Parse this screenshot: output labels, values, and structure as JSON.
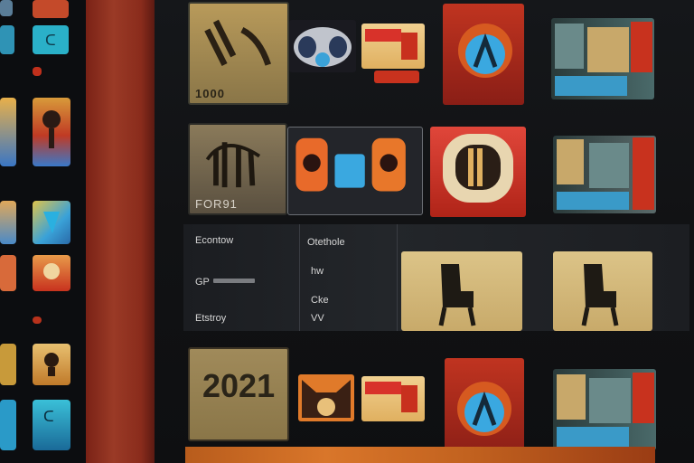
{
  "grid": {
    "row1": {
      "tile_label": "1000"
    },
    "row2": {
      "tile_label": "FOR91"
    },
    "row4": {
      "tile_label": "2021"
    }
  },
  "settings": {
    "col1_header": "Econtow",
    "col1_item1": "GP",
    "col1_item2": "Etstroy",
    "col2_header": "Otethole",
    "col2_item1": "hw",
    "col2_item2": "Cke",
    "col2_item3": "VV"
  },
  "colors": {
    "accent_red": "#c8321e",
    "accent_orange": "#e0762a",
    "accent_blue": "#3aa2d8",
    "tan": "#d9bf7a"
  }
}
